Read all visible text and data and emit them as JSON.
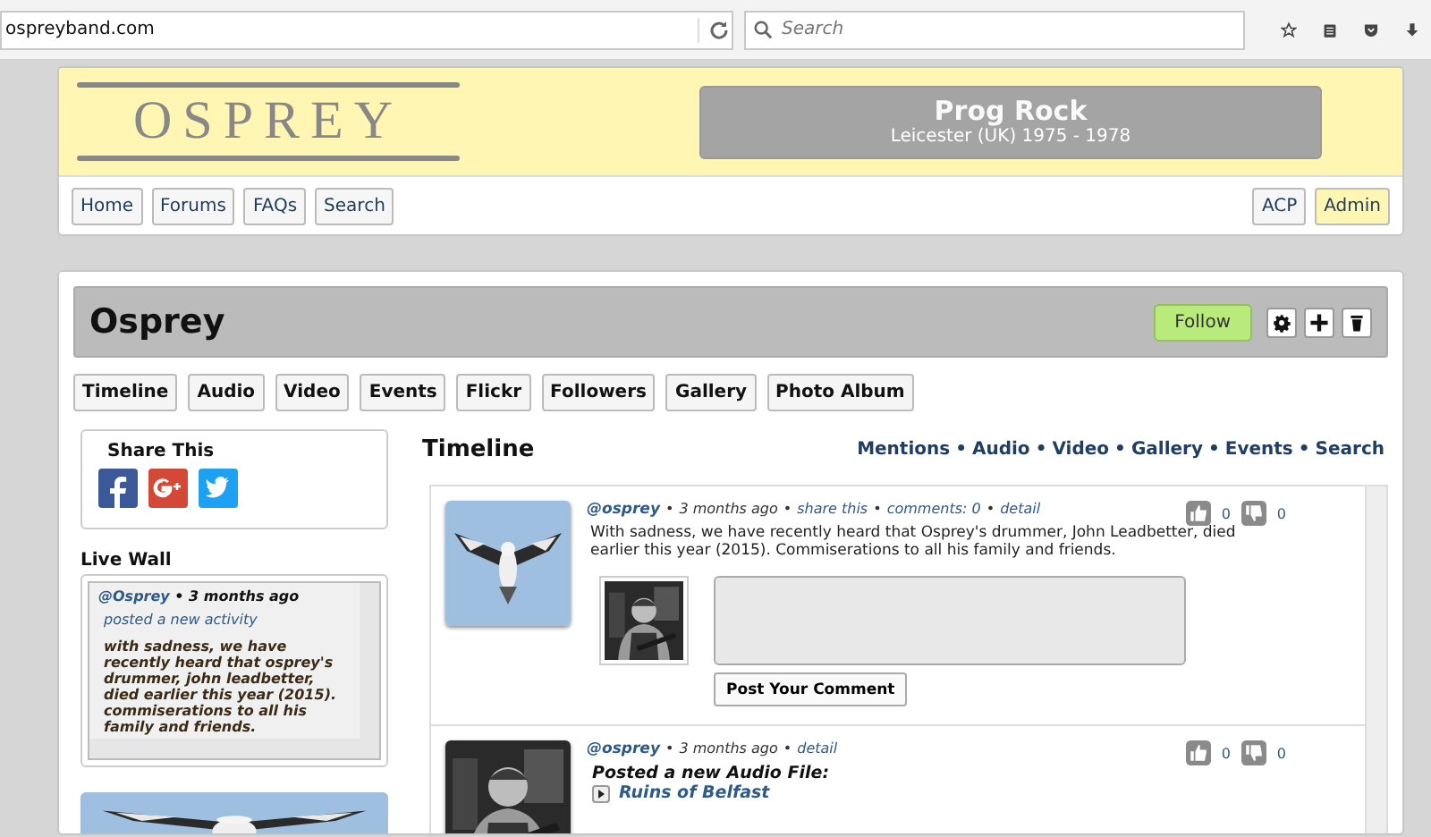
{
  "browser": {
    "url": "ospreyband.com",
    "search_placeholder": "Search"
  },
  "header": {
    "logo": "OSPREY",
    "title": "Prog Rock",
    "subtitle": "Leicester (UK) 1975 - 1978"
  },
  "nav": {
    "left": [
      {
        "label": "Home",
        "highlighted": false
      },
      {
        "label": "Forums",
        "highlighted": false
      },
      {
        "label": "FAQs",
        "highlighted": false
      },
      {
        "label": "Search",
        "highlighted": false
      }
    ],
    "right": [
      {
        "label": "ACP",
        "highlighted": false
      },
      {
        "label": "Admin",
        "highlighted": true
      }
    ]
  },
  "profile": {
    "name": "Osprey",
    "follow_button": "Follow"
  },
  "tabs": [
    "Timeline",
    "Audio",
    "Video",
    "Events",
    "Flickr",
    "Followers",
    "Gallery",
    "Photo Album"
  ],
  "share": {
    "title": "Share This"
  },
  "live_wall": {
    "title": "Live Wall",
    "entries": [
      {
        "user": "@Osprey",
        "separator": "•",
        "time": "3 months ago",
        "action": "posted a new activity",
        "text": "with sadness, we have recently heard that osprey's drummer, john leadbetter, died earlier this year (2015). commiserations to all his family and friends."
      }
    ]
  },
  "timeline": {
    "title": "Timeline",
    "separator": "•",
    "links": [
      "Mentions",
      "Audio",
      "Video",
      "Gallery",
      "Events",
      "Search"
    ],
    "posts": [
      {
        "kind": "status",
        "user": "@osprey",
        "time": "3 months ago",
        "links": [
          "share this",
          "comments: 0",
          "detail"
        ],
        "text": "With sadness, we have recently heard that Osprey's drummer, John Leadbetter, died earlier this year (2015). Commiserations to all his family and friends.",
        "comment_button": "Post Your Comment",
        "likes": "0",
        "dislikes": "0"
      },
      {
        "kind": "audio",
        "user": "@osprey",
        "time": "3 months ago",
        "links": [
          "detail"
        ],
        "heading": "Posted a new Audio File:",
        "track": "Ruins of Belfast",
        "likes": "0",
        "dislikes": "0"
      }
    ]
  }
}
